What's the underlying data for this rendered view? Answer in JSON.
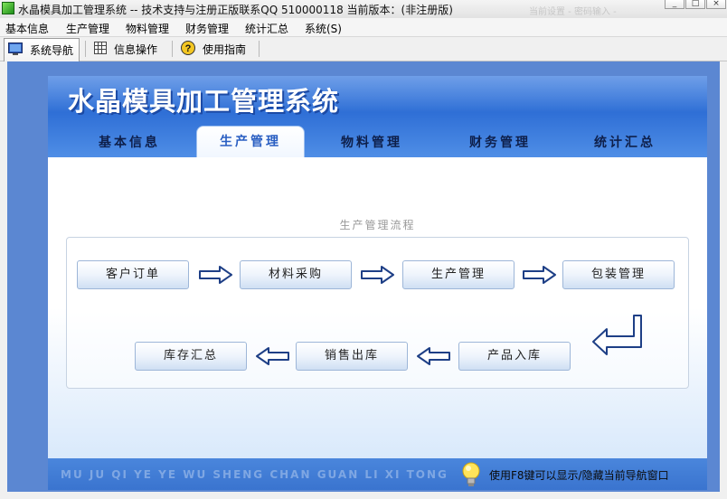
{
  "window": {
    "title": "水晶模具加工管理系统 -- 技术支持与注册正版联系QQ 510000118    当前版本：(非注册版)",
    "ghost_text": "当前设置 - 密码输入 -"
  },
  "menubar": {
    "items": [
      "基本信息",
      "生产管理",
      "物料管理",
      "财务管理",
      "统计汇总",
      "系统(S)"
    ]
  },
  "toolbar": {
    "items": [
      {
        "label": "系统导航",
        "icon": "monitor-icon"
      },
      {
        "label": "信息操作",
        "icon": "grid-icon"
      },
      {
        "label": "使用指南",
        "icon": "help-icon"
      }
    ]
  },
  "app": {
    "title": "水晶模具加工管理系统",
    "tabs": [
      "基本信息",
      "生产管理",
      "物料管理",
      "财务管理",
      "统计汇总"
    ],
    "active_tab": "生产管理"
  },
  "flow": {
    "title": "生产管理流程",
    "row1": [
      "客户订单",
      "材料采购",
      "生产管理",
      "包装管理"
    ],
    "row2": [
      "库存汇总",
      "销售出库",
      "产品入库"
    ]
  },
  "footer": {
    "pinyin": "MU JU QI YE YE WU SHENG CHAN GUAN LI XI TONG",
    "hint": "使用F8键可以显示/隐藏当前导航窗口"
  },
  "colors": {
    "banner_blue": "#2f6fd6",
    "accent_blue": "#2a5fc2"
  }
}
